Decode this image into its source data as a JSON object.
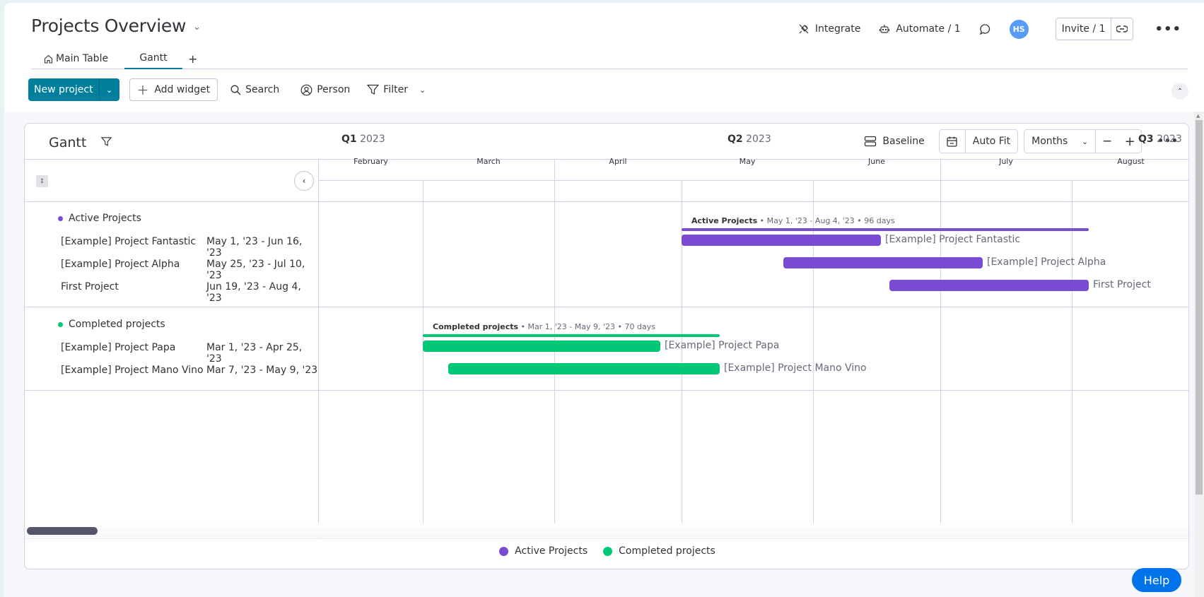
{
  "header": {
    "title": "Projects Overview",
    "integrate_label": "Integrate",
    "automate_label": "Automate / 1",
    "avatar_initials": "HS",
    "invite_label": "Invite / 1"
  },
  "tabs": [
    {
      "label": "Main Table",
      "icon": "home-icon",
      "active": false
    },
    {
      "label": "Gantt",
      "active": true
    },
    {
      "label": "+",
      "icon": "add-view"
    }
  ],
  "toolbar": {
    "new_project_label": "New project",
    "add_widget_label": "Add widget",
    "search_label": "Search",
    "person_label": "Person",
    "filter_label": "Filter"
  },
  "gantt": {
    "title": "Gantt",
    "baseline_label": "Baseline",
    "auto_fit_label": "Auto Fit",
    "scale_select": "Months",
    "quarters": [
      {
        "q": "Q1",
        "year": "2023"
      },
      {
        "q": "Q2",
        "year": "2023"
      },
      {
        "q": "Q3",
        "year": "2023"
      }
    ],
    "months": [
      "February",
      "March",
      "April",
      "May",
      "June",
      "July",
      "August"
    ]
  },
  "chart_data": {
    "type": "gantt",
    "timescale": "Months",
    "visible_range": [
      "2023-02",
      "2023-08"
    ],
    "groups": [
      {
        "name": "Active Projects",
        "color": "#784bd1",
        "summary_range": "May 1, '23 - Aug 4, '23",
        "summary_days": "96 days",
        "start": "2023-05-01",
        "end": "2023-08-04",
        "items": [
          {
            "name": "[Example] Project Fantastic",
            "dates": "May 1, '23 - Jun 16, '23",
            "start": "2023-05-01",
            "end": "2023-06-16"
          },
          {
            "name": "[Example] Project Alpha",
            "dates": "May 25, '23 - Jul 10, '23",
            "start": "2023-05-25",
            "end": "2023-07-10"
          },
          {
            "name": "First Project",
            "dates": "Jun 19, '23 - Aug 4, '23",
            "start": "2023-06-19",
            "end": "2023-08-04"
          }
        ]
      },
      {
        "name": "Completed projects",
        "color": "#00c875",
        "summary_range": "Mar 1, '23 - May 9, '23",
        "summary_days": "70 days",
        "start": "2023-03-01",
        "end": "2023-05-09",
        "items": [
          {
            "name": "[Example] Project Papa",
            "dates": "Mar 1, '23 - Apr 25, '23",
            "start": "2023-03-01",
            "end": "2023-04-25"
          },
          {
            "name": "[Example] Project Mano Vino",
            "dates": "Mar 7, '23 - May 9, '23",
            "start": "2023-03-07",
            "end": "2023-05-09"
          }
        ]
      }
    ],
    "legend": [
      {
        "label": "Active Projects",
        "color": "#784bd1"
      },
      {
        "label": "Completed projects",
        "color": "#00c875"
      }
    ]
  },
  "help_label": "Help"
}
